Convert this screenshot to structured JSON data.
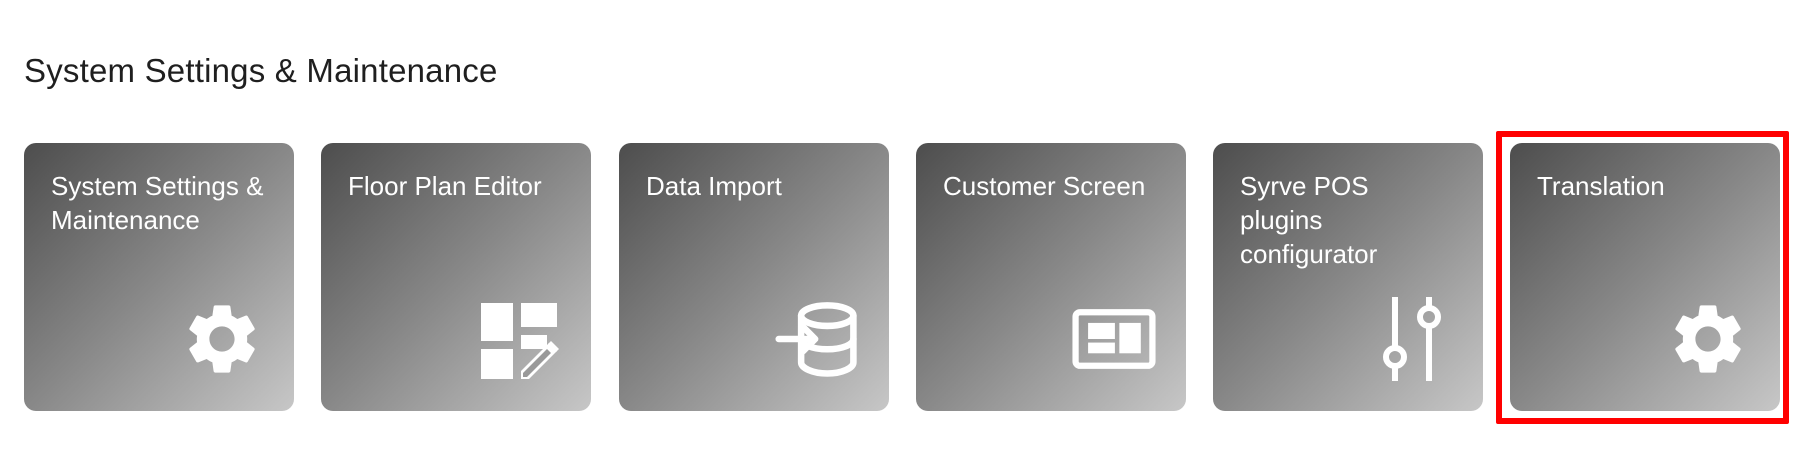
{
  "section": {
    "title": "System Settings & Maintenance"
  },
  "tiles": [
    {
      "label": "System Settings & Maintenance",
      "icon": "gear-icon"
    },
    {
      "label": "Floor Plan Editor",
      "icon": "floor-plan-edit-icon"
    },
    {
      "label": "Data Import",
      "icon": "database-import-icon"
    },
    {
      "label": "Customer Screen",
      "icon": "customer-display-icon"
    },
    {
      "label": "Syrve POS\nplugins\nconfigurator",
      "icon": "sliders-icon"
    },
    {
      "label": "Translation",
      "icon": "gear-icon"
    }
  ],
  "highlight": {
    "target": "Translation",
    "color": "#ff0000"
  },
  "colors": {
    "tile_gradient_start": "#4d4d4d",
    "tile_gradient_end": "#c7c7c7",
    "tile_text": "#ffffff",
    "title_text": "#1f1f1f"
  }
}
